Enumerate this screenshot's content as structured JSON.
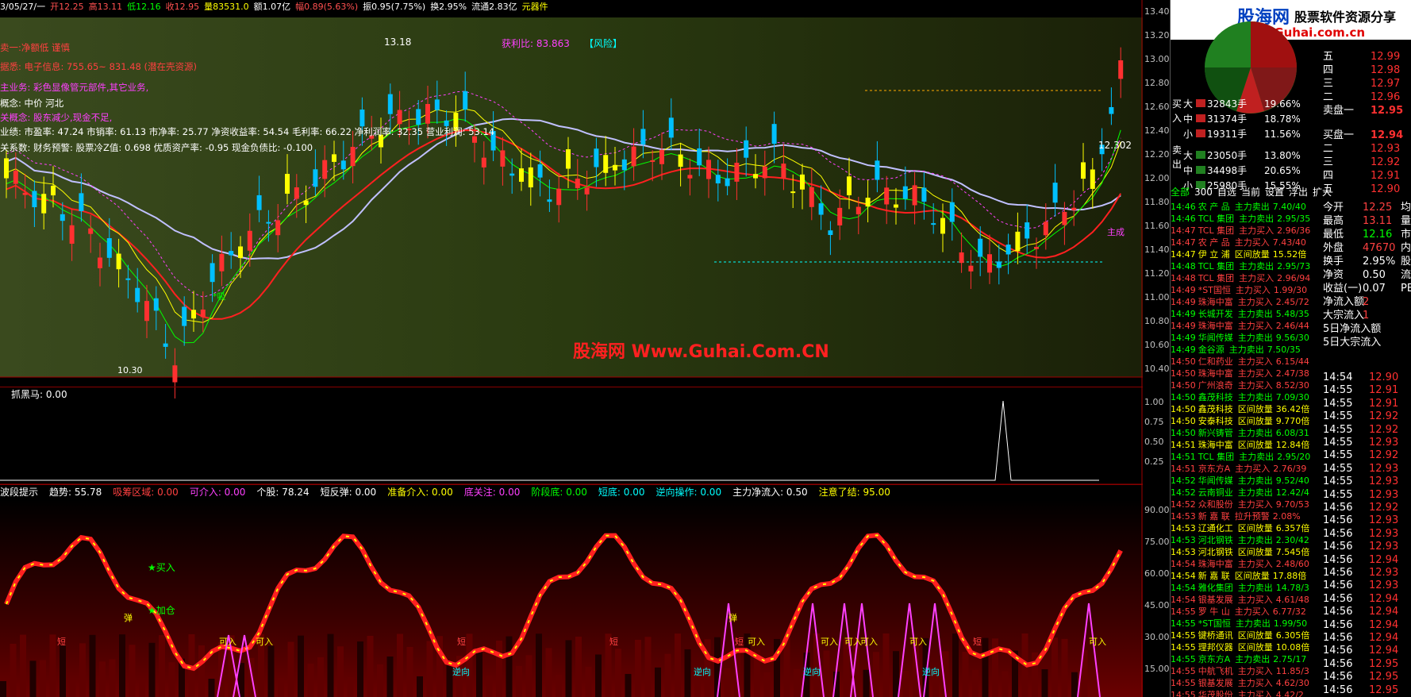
{
  "header": {
    "items": [
      {
        "text": "3/05/27/一",
        "color": "#ffffff"
      },
      {
        "text": "开12.25",
        "color": "#ff5050"
      },
      {
        "text": "高13.11",
        "color": "#ff5050"
      },
      {
        "text": "低12.16",
        "color": "#00ff00"
      },
      {
        "text": "收12.95",
        "color": "#ff5050"
      },
      {
        "text": "量83531.0",
        "color": "#ffff00"
      },
      {
        "text": "额1.07亿",
        "color": "#ffffff"
      },
      {
        "text": "幅0.89(5.63%)",
        "color": "#ff5050"
      },
      {
        "text": "振0.95(7.75%)",
        "color": "#ffffff"
      },
      {
        "text": "换2.95%",
        "color": "#ffffff"
      },
      {
        "text": "流通2.83亿",
        "color": "#ffffff"
      },
      {
        "text": "元器件",
        "color": "#ffff00"
      }
    ]
  },
  "info_lines": [
    {
      "text": "卖一:净额低 谨慎",
      "color": "#ff4040"
    },
    {
      "text": "据悉: 电子信息: 755.65~ 831.48 (潜在壳资源)",
      "color": "#ff4040"
    },
    {
      "text": "主业务: 彩色显像管元部件,其它业务,",
      "color": "#ff40ff"
    },
    {
      "text": "概念: 中价 河北",
      "color": "#ffffff"
    },
    {
      "text": "关概念: 股东减少,现金不足,",
      "color": "#ff40ff"
    },
    {
      "text": "业绩: 市盈率: 47.24 市销率: 61.13 市净率: 25.77 净资收益率: 54.54 毛利率: 66.22 净利润率: 32.35 营业利润: 53.14",
      "color": "#ffffff"
    },
    {
      "text": "关系数: 财务预警: 股票冷Z值: 0.698 优质资产率: -0.95 现金负债比: -0.100",
      "color": "#ffffff"
    }
  ],
  "main_labels": {
    "high_label": "13.18",
    "profit_ratio": "获利比: 83.863",
    "risk": "【风险】",
    "low_label": "10.30",
    "last_price": "12.302",
    "zhucheng": "主成",
    "xi_label": "*吸"
  },
  "watermark": "股海网 Www.Guhai.Com.CN",
  "price_axis": [
    "13.40",
    "13.20",
    "13.00",
    "12.80",
    "12.60",
    "12.40",
    "12.20",
    "12.00",
    "11.80",
    "11.60",
    "11.40",
    "11.20",
    "11.00",
    "10.80",
    "10.60",
    "10.40"
  ],
  "mid_indicator": {
    "title": "抓黑马: 0.00",
    "axis": [
      "1.00",
      "0.75",
      "0.50",
      "0.25"
    ]
  },
  "bottom_indicator": {
    "items": [
      {
        "text": "波段提示",
        "color": "#ffffff"
      },
      {
        "text": "趋势: 55.78",
        "color": "#ffffff"
      },
      {
        "text": "吸筹区域: 0.00",
        "color": "#ff4040"
      },
      {
        "text": "可介入: 0.00",
        "color": "#ff40ff"
      },
      {
        "text": "个股: 78.24",
        "color": "#ffffff"
      },
      {
        "text": "短反弹: 0.00",
        "color": "#ffffff"
      },
      {
        "text": "准备介入: 0.00",
        "color": "#ffff00"
      },
      {
        "text": "底关注: 0.00",
        "color": "#ff40ff"
      },
      {
        "text": "阶段底: 0.00",
        "color": "#00ff00"
      },
      {
        "text": "短底: 0.00",
        "color": "#00ffff"
      },
      {
        "text": "逆向操作: 0.00",
        "color": "#00ffff"
      },
      {
        "text": "主力净流入: 0.50",
        "color": "#ffffff"
      },
      {
        "text": "注意了结: 95.00",
        "color": "#ffff00"
      }
    ],
    "axis": [
      "90.00",
      "75.00",
      "60.00",
      "45.00",
      "30.00",
      "15.00"
    ],
    "labels": {
      "buy": "★买入",
      "add": "★加仓",
      "dan": "弹",
      "duan": "短",
      "kejie": "可入",
      "nixiang": "逆向"
    }
  },
  "right_panel": {
    "logo_cn": "股海网",
    "logo_tag": "股票软件资源分享",
    "logo_url": "www.Guhai.com.cn",
    "flows": {
      "buy_side": "买入",
      "sell_side": "卖出",
      "rows": [
        {
          "label": "大",
          "value": "32843手",
          "pct": "19.66%"
        },
        {
          "label": "中",
          "value": "31374手",
          "pct": "18.78%"
        },
        {
          "label": "小",
          "value": "19311手",
          "pct": "11.56%"
        },
        {
          "label": "大",
          "value": "23050手",
          "pct": "13.80%"
        },
        {
          "label": "中",
          "value": "34498手",
          "pct": "20.65%"
        },
        {
          "label": "小",
          "value": "25980手",
          "pct": "15.55%"
        }
      ]
    },
    "tabs": [
      "全部",
      "300",
      "自选",
      "当前",
      "设置",
      "浮出",
      "扩大"
    ],
    "ticks": [
      {
        "time": "14:46",
        "name": "农 产 品",
        "type": "主力卖出",
        "val": "7.40/40",
        "c": "#00ff00"
      },
      {
        "time": "14:46",
        "name": "TCL 集团",
        "type": "主力卖出",
        "val": "2.95/35",
        "c": "#00ff00"
      },
      {
        "time": "14:47",
        "name": "TCL 集团",
        "type": "主力买入",
        "val": "2.96/36",
        "c": "#ff4040"
      },
      {
        "time": "14:47",
        "name": "农 产 品",
        "type": "主力买入",
        "val": "7.43/40",
        "c": "#ff4040"
      },
      {
        "time": "14:47",
        "name": "伊 立 浦",
        "type": "区间放量",
        "val": "15.52倍",
        "c": "#ffff00"
      },
      {
        "time": "14:48",
        "name": "TCL 集团",
        "type": "主力卖出",
        "val": "2.95/73",
        "c": "#00ff00"
      },
      {
        "time": "14:48",
        "name": "TCL 集团",
        "type": "主力买入",
        "val": "2.96/94",
        "c": "#ff4040"
      },
      {
        "time": "14:49",
        "name": "*ST国恒",
        "type": "主力买入",
        "val": "1.99/30",
        "c": "#ff4040"
      },
      {
        "time": "14:49",
        "name": "珠海中富",
        "type": "主力买入",
        "val": "2.45/72",
        "c": "#ff4040"
      },
      {
        "time": "14:49",
        "name": "长城开发",
        "type": "主力卖出",
        "val": "5.48/35",
        "c": "#00ff00"
      },
      {
        "time": "14:49",
        "name": "珠海中富",
        "type": "主力买入",
        "val": "2.46/44",
        "c": "#ff4040"
      },
      {
        "time": "14:49",
        "name": "华闻传媒",
        "type": "主力卖出",
        "val": "9.56/30",
        "c": "#00ff00"
      },
      {
        "time": "14:49",
        "name": "金谷源",
        "type": "主力卖出",
        "val": "7.50/35",
        "c": "#00ff00"
      },
      {
        "time": "14:50",
        "name": "仁和药业",
        "type": "主力买入",
        "val": "6.15/44",
        "c": "#ff4040"
      },
      {
        "time": "14:50",
        "name": "珠海中富",
        "type": "主力买入",
        "val": "2.47/38",
        "c": "#ff4040"
      },
      {
        "time": "14:50",
        "name": "广州浪奇",
        "type": "主力买入",
        "val": "8.52/30",
        "c": "#ff4040"
      },
      {
        "time": "14:50",
        "name": "鑫茂科技",
        "type": "主力卖出",
        "val": "7.09/30",
        "c": "#00ff00"
      },
      {
        "time": "14:50",
        "name": "鑫茂科技",
        "type": "区间放量",
        "val": "36.42倍",
        "c": "#ffff00"
      },
      {
        "time": "14:50",
        "name": "安泰科技",
        "type": "区间放量",
        "val": "9.770倍",
        "c": "#ffff00"
      },
      {
        "time": "14:50",
        "name": "新兴铸管",
        "type": "主力卖出",
        "val": "6.08/31",
        "c": "#00ff00"
      },
      {
        "time": "14:51",
        "name": "珠海中富",
        "type": "区间放量",
        "val": "12.84倍",
        "c": "#ffff00"
      },
      {
        "time": "14:51",
        "name": "TCL 集团",
        "type": "主力卖出",
        "val": "2.95/20",
        "c": "#00ff00"
      },
      {
        "time": "14:51",
        "name": "京东方A",
        "type": "主力买入",
        "val": "2.76/39",
        "c": "#ff4040"
      },
      {
        "time": "14:52",
        "name": "华闻传媒",
        "type": "主力卖出",
        "val": "9.52/40",
        "c": "#00ff00"
      },
      {
        "time": "14:52",
        "name": "云南铜业",
        "type": "主力卖出",
        "val": "12.42/4",
        "c": "#00ff00"
      },
      {
        "time": "14:52",
        "name": "众和股份",
        "type": "主力买入",
        "val": "9.70/53",
        "c": "#ff4040"
      },
      {
        "time": "14:53",
        "name": "新 嘉 联",
        "type": "拉升预警",
        "val": "2.08%",
        "c": "#ff4040"
      },
      {
        "time": "14:53",
        "name": "辽通化工",
        "type": "区间放量",
        "val": "6.357倍",
        "c": "#ffff00"
      },
      {
        "time": "14:53",
        "name": "河北钢铁",
        "type": "主力卖出",
        "val": "2.30/42",
        "c": "#00ff00"
      },
      {
        "time": "14:53",
        "name": "河北钢铁",
        "type": "区间放量",
        "val": "7.545倍",
        "c": "#ffff00"
      },
      {
        "time": "14:54",
        "name": "珠海中富",
        "type": "主力买入",
        "val": "2.48/60",
        "c": "#ff4040"
      },
      {
        "time": "14:54",
        "name": "新 嘉 联",
        "type": "区间放量",
        "val": "17.88倍",
        "c": "#ffff00"
      },
      {
        "time": "14:54",
        "name": "雅化集团",
        "type": "主力卖出",
        "val": "14.78/3",
        "c": "#00ff00"
      },
      {
        "time": "14:54",
        "name": "银基发展",
        "type": "主力买入",
        "val": "4.61/48",
        "c": "#ff4040"
      },
      {
        "time": "14:55",
        "name": "罗 牛 山",
        "type": "主力买入",
        "val": "6.77/32",
        "c": "#ff4040"
      },
      {
        "time": "14:55",
        "name": "*ST国恒",
        "type": "主力卖出",
        "val": "1.99/50",
        "c": "#00ff00"
      },
      {
        "time": "14:55",
        "name": "键桥通讯",
        "type": "区间放量",
        "val": "6.305倍",
        "c": "#ffff00"
      },
      {
        "time": "14:55",
        "name": "理邦仪器",
        "type": "区间放量",
        "val": "10.08倍",
        "c": "#ffff00"
      },
      {
        "time": "14:55",
        "name": "京东方A",
        "type": "主力卖出",
        "val": "2.75/17",
        "c": "#00ff00"
      },
      {
        "time": "14:55",
        "name": "中航飞机",
        "type": "主力买入",
        "val": "11.85/3",
        "c": "#ff4040"
      },
      {
        "time": "14:55",
        "name": "银基发展",
        "type": "主力买入",
        "val": "4.62/30",
        "c": "#ff4040"
      },
      {
        "time": "14:55",
        "name": "华茂股份",
        "type": "主力买入",
        "val": "4.42/2",
        "c": "#ff4040"
      }
    ],
    "quote_book": [
      {
        "label": "五",
        "price": "12.99"
      },
      {
        "label": "四",
        "price": "12.98"
      },
      {
        "label": "三",
        "price": "12.97"
      },
      {
        "label": "二",
        "price": "12.96"
      },
      {
        "label": "卖盘一",
        "price": "12.95"
      },
      {
        "label": "买盘一",
        "price": "12.94"
      },
      {
        "label": "二",
        "price": "12.93"
      },
      {
        "label": "三",
        "price": "12.92"
      },
      {
        "label": "四",
        "price": "12.91"
      },
      {
        "label": "五",
        "price": "12.90"
      }
    ],
    "stats": [
      {
        "label": "今开",
        "value": "12.25",
        "c": "#ff4040",
        "extra": "均"
      },
      {
        "label": "最高",
        "value": "13.11",
        "c": "#ff4040",
        "extra": "量"
      },
      {
        "label": "最低",
        "value": "12.16",
        "c": "#00ff00",
        "extra": "市"
      },
      {
        "label": "外盘",
        "value": "47670",
        "c": "#ff4040",
        "extra": "内"
      },
      {
        "label": "换手",
        "value": "2.95%",
        "c": "#ffffff",
        "extra": "股"
      },
      {
        "label": "净资",
        "value": "0.50",
        "c": "#ffffff",
        "extra": "流"
      },
      {
        "label": "收益(一)",
        "value": "0.07",
        "c": "#ffffff",
        "extra": "PE"
      },
      {
        "label": "净流入额",
        "value": "2",
        "c": "#ff4040",
        "extra": ""
      },
      {
        "label": "大宗流入",
        "value": "1",
        "c": "#ff4040",
        "extra": ""
      },
      {
        "label": "5日净流入额",
        "value": "",
        "c": "#ffffff",
        "extra": ""
      },
      {
        "label": "5日大宗流入",
        "value": "",
        "c": "#ffffff",
        "extra": ""
      }
    ],
    "trades": [
      {
        "t": "14:54",
        "p": "12.90"
      },
      {
        "t": "14:55",
        "p": "12.91"
      },
      {
        "t": "14:55",
        "p": "12.91"
      },
      {
        "t": "14:55",
        "p": "12.92"
      },
      {
        "t": "14:55",
        "p": "12.92"
      },
      {
        "t": "14:55",
        "p": "12.93"
      },
      {
        "t": "14:55",
        "p": "12.92"
      },
      {
        "t": "14:55",
        "p": "12.93"
      },
      {
        "t": "14:55",
        "p": "12.93"
      },
      {
        "t": "14:55",
        "p": "12.93"
      },
      {
        "t": "14:56",
        "p": "12.92"
      },
      {
        "t": "14:56",
        "p": "12.93"
      },
      {
        "t": "14:56",
        "p": "12.93"
      },
      {
        "t": "14:56",
        "p": "12.93"
      },
      {
        "t": "14:56",
        "p": "12.94"
      },
      {
        "t": "14:56",
        "p": "12.93"
      },
      {
        "t": "14:56",
        "p": "12.93"
      },
      {
        "t": "14:56",
        "p": "12.94"
      },
      {
        "t": "14:56",
        "p": "12.94"
      },
      {
        "t": "14:56",
        "p": "12.94"
      },
      {
        "t": "14:56",
        "p": "12.94"
      },
      {
        "t": "14:56",
        "p": "12.94"
      },
      {
        "t": "14:56",
        "p": "12.95"
      },
      {
        "t": "14:56",
        "p": "12.95"
      },
      {
        "t": "14:56",
        "p": "12.95"
      }
    ]
  }
}
